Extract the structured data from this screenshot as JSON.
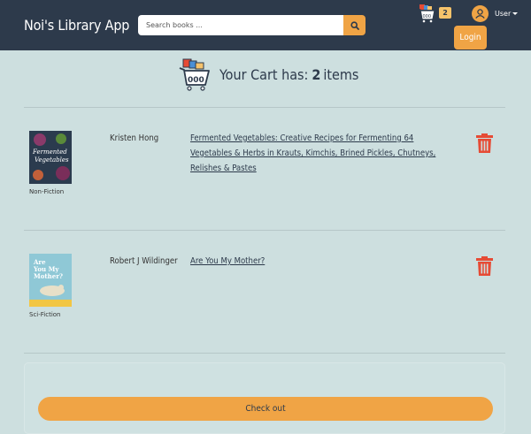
{
  "navbar": {
    "brand": "Noi's Library App",
    "search_placeholder": "Search books ...",
    "search_icon": "magnifier-icon",
    "cart_icon": "shopping-cart-icon",
    "cart_badge": "2",
    "user_icon": "user-circle-icon",
    "user_label": "User",
    "login_label": "Login"
  },
  "cart": {
    "icon": "shopping-cart-icon",
    "title_prefix": "Your Cart has:",
    "count": "2",
    "title_suffix": "items"
  },
  "items": [
    {
      "cover_label": "Fermented Vegetables",
      "genre": "Non-Fiction",
      "author": "Kristen Hong",
      "title": "Fermented Vegetables: Creative Recipes for Fermenting 64 Vegetables & Herbs in Krauts, Kimchis, Brined Pickles, Chutneys, Relishes & Pastes",
      "delete_icon": "trash-icon"
    },
    {
      "cover_label": "Are You My Mother?",
      "genre": "Sci-Fiction",
      "author": "Robert J Wildinger",
      "title": "Are You My Mother?",
      "delete_icon": "trash-icon"
    }
  ],
  "checkout": {
    "label": "Check out"
  },
  "colors": {
    "navbar": "#2d3a4b",
    "accent": "#f0a445",
    "background": "#cddfdf",
    "danger": "#e64b35"
  }
}
